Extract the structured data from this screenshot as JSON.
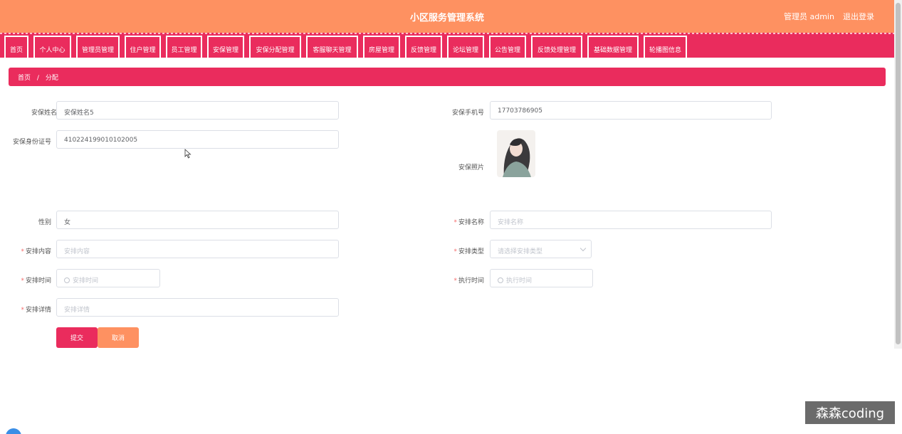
{
  "header": {
    "title": "小区服务管理系统",
    "user": "管理员 admin",
    "logout": "退出登录"
  },
  "nav": {
    "tabs": [
      "首页",
      "个人中心",
      "管理员管理",
      "住户管理",
      "员工管理",
      "安保管理",
      "安保分配管理",
      "客服聊天管理",
      "房屋管理",
      "反馈管理",
      "论坛管理",
      "公告管理",
      "反馈处理管理",
      "基础数据管理",
      "轮播图信息"
    ]
  },
  "breadcrumb": {
    "home": "首页",
    "separator": "/",
    "current": "分配"
  },
  "form": {
    "guard_name": {
      "label": "安保姓名",
      "value": "安保姓名5"
    },
    "guard_phone": {
      "label": "安保手机号",
      "value": "17703786905"
    },
    "guard_id": {
      "label": "安保身份证号",
      "value": "410224199010102005"
    },
    "guard_photo": {
      "label": "安保照片"
    },
    "gender": {
      "label": "性别",
      "value": "女"
    },
    "arrange_name": {
      "label": "安排名称",
      "placeholder": "安排名称",
      "required": "*"
    },
    "arrange_content": {
      "label": "安排内容",
      "placeholder": "安排内容",
      "required": "*"
    },
    "arrange_type": {
      "label": "安排类型",
      "placeholder": "请选择安排类型",
      "required": "*"
    },
    "arrange_time": {
      "label": "安排时间",
      "placeholder": "安排时间",
      "required": "*"
    },
    "exec_time": {
      "label": "执行时间",
      "placeholder": "执行时间",
      "required": "*"
    },
    "arrange_detail": {
      "label": "安排详情",
      "placeholder": "安排详情",
      "required": "*"
    }
  },
  "buttons": {
    "submit": "提交",
    "cancel": "取消"
  },
  "watermark": "森森coding",
  "colors": {
    "header": "#fe9161",
    "accent": "#ea2c5d"
  }
}
